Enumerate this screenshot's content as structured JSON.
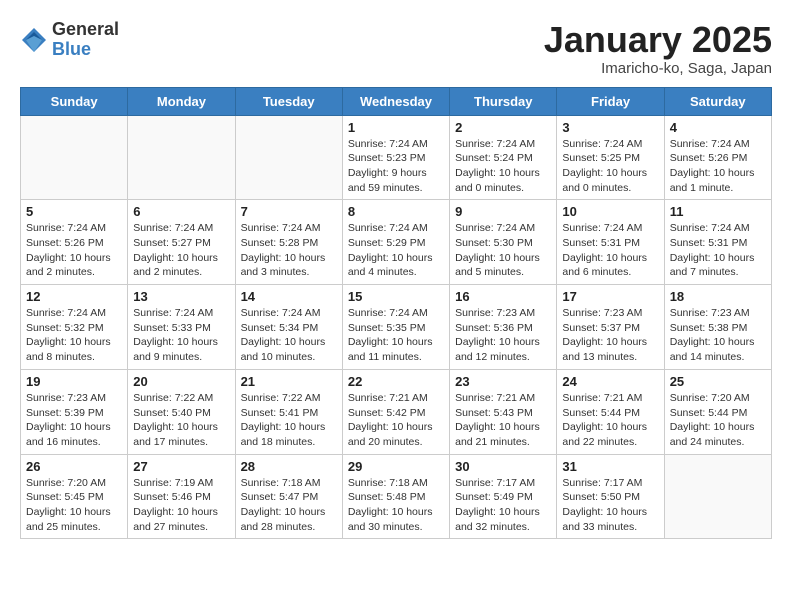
{
  "header": {
    "logo_general": "General",
    "logo_blue": "Blue",
    "month_title": "January 2025",
    "location": "Imaricho-ko, Saga, Japan"
  },
  "weekdays": [
    "Sunday",
    "Monday",
    "Tuesday",
    "Wednesday",
    "Thursday",
    "Friday",
    "Saturday"
  ],
  "weeks": [
    [
      {
        "day": "",
        "info": ""
      },
      {
        "day": "",
        "info": ""
      },
      {
        "day": "",
        "info": ""
      },
      {
        "day": "1",
        "info": "Sunrise: 7:24 AM\nSunset: 5:23 PM\nDaylight: 9 hours\nand 59 minutes."
      },
      {
        "day": "2",
        "info": "Sunrise: 7:24 AM\nSunset: 5:24 PM\nDaylight: 10 hours\nand 0 minutes."
      },
      {
        "day": "3",
        "info": "Sunrise: 7:24 AM\nSunset: 5:25 PM\nDaylight: 10 hours\nand 0 minutes."
      },
      {
        "day": "4",
        "info": "Sunrise: 7:24 AM\nSunset: 5:26 PM\nDaylight: 10 hours\nand 1 minute."
      }
    ],
    [
      {
        "day": "5",
        "info": "Sunrise: 7:24 AM\nSunset: 5:26 PM\nDaylight: 10 hours\nand 2 minutes."
      },
      {
        "day": "6",
        "info": "Sunrise: 7:24 AM\nSunset: 5:27 PM\nDaylight: 10 hours\nand 2 minutes."
      },
      {
        "day": "7",
        "info": "Sunrise: 7:24 AM\nSunset: 5:28 PM\nDaylight: 10 hours\nand 3 minutes."
      },
      {
        "day": "8",
        "info": "Sunrise: 7:24 AM\nSunset: 5:29 PM\nDaylight: 10 hours\nand 4 minutes."
      },
      {
        "day": "9",
        "info": "Sunrise: 7:24 AM\nSunset: 5:30 PM\nDaylight: 10 hours\nand 5 minutes."
      },
      {
        "day": "10",
        "info": "Sunrise: 7:24 AM\nSunset: 5:31 PM\nDaylight: 10 hours\nand 6 minutes."
      },
      {
        "day": "11",
        "info": "Sunrise: 7:24 AM\nSunset: 5:31 PM\nDaylight: 10 hours\nand 7 minutes."
      }
    ],
    [
      {
        "day": "12",
        "info": "Sunrise: 7:24 AM\nSunset: 5:32 PM\nDaylight: 10 hours\nand 8 minutes."
      },
      {
        "day": "13",
        "info": "Sunrise: 7:24 AM\nSunset: 5:33 PM\nDaylight: 10 hours\nand 9 minutes."
      },
      {
        "day": "14",
        "info": "Sunrise: 7:24 AM\nSunset: 5:34 PM\nDaylight: 10 hours\nand 10 minutes."
      },
      {
        "day": "15",
        "info": "Sunrise: 7:24 AM\nSunset: 5:35 PM\nDaylight: 10 hours\nand 11 minutes."
      },
      {
        "day": "16",
        "info": "Sunrise: 7:23 AM\nSunset: 5:36 PM\nDaylight: 10 hours\nand 12 minutes."
      },
      {
        "day": "17",
        "info": "Sunrise: 7:23 AM\nSunset: 5:37 PM\nDaylight: 10 hours\nand 13 minutes."
      },
      {
        "day": "18",
        "info": "Sunrise: 7:23 AM\nSunset: 5:38 PM\nDaylight: 10 hours\nand 14 minutes."
      }
    ],
    [
      {
        "day": "19",
        "info": "Sunrise: 7:23 AM\nSunset: 5:39 PM\nDaylight: 10 hours\nand 16 minutes."
      },
      {
        "day": "20",
        "info": "Sunrise: 7:22 AM\nSunset: 5:40 PM\nDaylight: 10 hours\nand 17 minutes."
      },
      {
        "day": "21",
        "info": "Sunrise: 7:22 AM\nSunset: 5:41 PM\nDaylight: 10 hours\nand 18 minutes."
      },
      {
        "day": "22",
        "info": "Sunrise: 7:21 AM\nSunset: 5:42 PM\nDaylight: 10 hours\nand 20 minutes."
      },
      {
        "day": "23",
        "info": "Sunrise: 7:21 AM\nSunset: 5:43 PM\nDaylight: 10 hours\nand 21 minutes."
      },
      {
        "day": "24",
        "info": "Sunrise: 7:21 AM\nSunset: 5:44 PM\nDaylight: 10 hours\nand 22 minutes."
      },
      {
        "day": "25",
        "info": "Sunrise: 7:20 AM\nSunset: 5:44 PM\nDaylight: 10 hours\nand 24 minutes."
      }
    ],
    [
      {
        "day": "26",
        "info": "Sunrise: 7:20 AM\nSunset: 5:45 PM\nDaylight: 10 hours\nand 25 minutes."
      },
      {
        "day": "27",
        "info": "Sunrise: 7:19 AM\nSunset: 5:46 PM\nDaylight: 10 hours\nand 27 minutes."
      },
      {
        "day": "28",
        "info": "Sunrise: 7:18 AM\nSunset: 5:47 PM\nDaylight: 10 hours\nand 28 minutes."
      },
      {
        "day": "29",
        "info": "Sunrise: 7:18 AM\nSunset: 5:48 PM\nDaylight: 10 hours\nand 30 minutes."
      },
      {
        "day": "30",
        "info": "Sunrise: 7:17 AM\nSunset: 5:49 PM\nDaylight: 10 hours\nand 32 minutes."
      },
      {
        "day": "31",
        "info": "Sunrise: 7:17 AM\nSunset: 5:50 PM\nDaylight: 10 hours\nand 33 minutes."
      },
      {
        "day": "",
        "info": ""
      }
    ]
  ]
}
